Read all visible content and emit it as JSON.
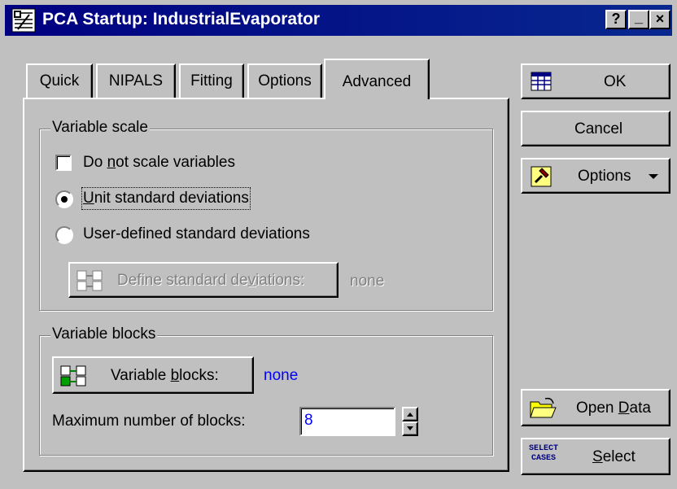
{
  "window": {
    "title": "PCA Startup: IndustrialEvaporator",
    "help_button": "?",
    "minimize_button": "_",
    "close_button": "×"
  },
  "tabs": [
    {
      "label": "Quick",
      "active": false
    },
    {
      "label": "NIPALS",
      "active": false
    },
    {
      "label": "Fitting",
      "active": false
    },
    {
      "label": "Options",
      "active": false
    },
    {
      "label": "Advanced",
      "active": true
    }
  ],
  "variable_scale": {
    "group_label": "Variable scale",
    "do_not_scale": {
      "pre": "Do ",
      "key": "n",
      "post": "ot scale variables",
      "checked": false
    },
    "unit_std": {
      "pre": "",
      "key": "U",
      "post": "nit standard deviations",
      "selected": true
    },
    "user_std": {
      "label": "User-defined standard deviations",
      "selected": false
    },
    "define_button": {
      "pre": "Define standard de",
      "key": "v",
      "post": "iations:",
      "enabled": false
    },
    "define_value": "none"
  },
  "variable_blocks": {
    "group_label": "Variable blocks",
    "blocks_button": {
      "pre": "Variable ",
      "key": "b",
      "post": "locks:"
    },
    "blocks_value": "none",
    "max_label": "Maximum number of blocks:",
    "max_value": "8"
  },
  "side_buttons": {
    "ok": "OK",
    "cancel": "Cancel",
    "options": "Options",
    "open_data": {
      "pre": "Open ",
      "key": "D",
      "post": "ata"
    },
    "select_cases_icon_text": [
      "SELECT",
      "CASES"
    ],
    "select": {
      "pre": "",
      "key": "S",
      "post": "elect"
    }
  }
}
